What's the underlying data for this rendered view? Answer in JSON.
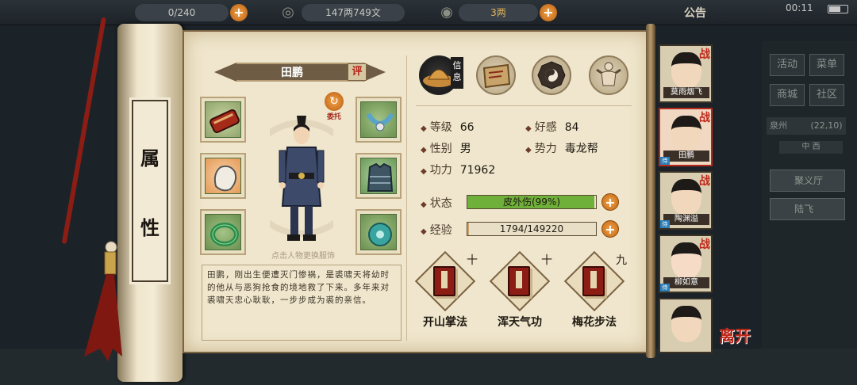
{
  "topbar": {
    "residents": "0/240",
    "coins": "147两749文",
    "gold": "3两",
    "announcement": "公告",
    "clock": "00:11"
  },
  "side_menu": {
    "buttons": [
      "活动",
      "菜单",
      "商城",
      "社区"
    ],
    "location": "泉州",
    "coords": "(22,10)",
    "direction": "中 西",
    "hall": "聚义厅",
    "npc": "陆飞"
  },
  "scroll": {
    "title_chars": [
      "属",
      "性"
    ]
  },
  "character": {
    "name": "田鹏",
    "rate_label": "评",
    "entrust_label": "委托",
    "hint": "点击人物更换服饰",
    "bio": "田鹏，刚出生便遭灭门惨祸，是裘啸天将幼时的他从与恶狗抢食的境地救了下来。多年来对裘啸天忠心耿耿，一步步成为裘的亲信。"
  },
  "tabs": {
    "info_label": "信息"
  },
  "stats": {
    "level_label": "等级",
    "level": "66",
    "favor_label": "好感",
    "favor": "84",
    "gender_label": "性别",
    "gender": "男",
    "faction_label": "势力",
    "faction": "毒龙帮",
    "power_label": "功力",
    "power": "71962",
    "status_label": "状态",
    "status": "皮外伤(99%)",
    "status_fill": 0.99,
    "exp_label": "经验",
    "exp": "1794/149220",
    "exp_fill": 0.012
  },
  "skills": [
    {
      "name": "开山掌法",
      "level": "十"
    },
    {
      "name": "浑天气功",
      "level": "十"
    },
    {
      "name": "梅花步法",
      "level": "九"
    }
  ],
  "roster": [
    {
      "name": "莫雨烟飞",
      "battle": "战",
      "tag": ""
    },
    {
      "name": "田鹏",
      "battle": "战",
      "tag": "侍"
    },
    {
      "name": "陶渊溢",
      "battle": "战",
      "tag": "侍"
    },
    {
      "name": "柳如意",
      "battle": "战",
      "tag": "侍"
    },
    {
      "name": "",
      "battle": "",
      "tag": ""
    }
  ],
  "leave_label": "离开",
  "colors": {
    "status_bar": "#6fb03a",
    "exp_bar": "#c9a36b",
    "accent_red": "#c1281a"
  }
}
